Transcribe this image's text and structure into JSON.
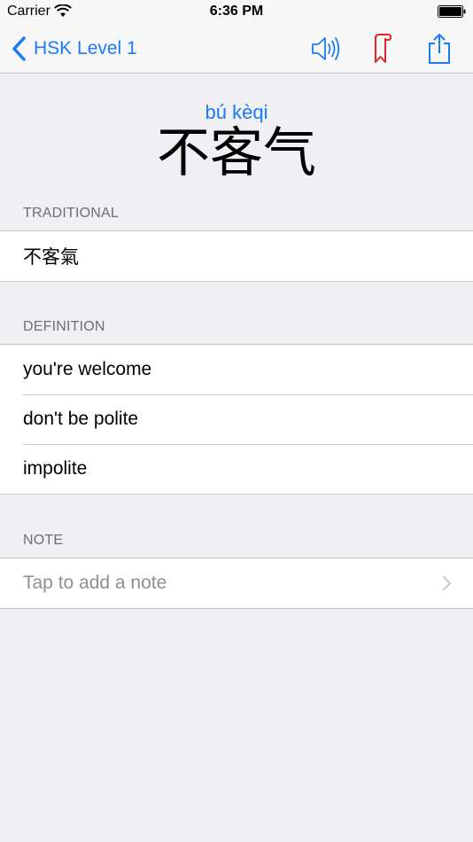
{
  "status_bar": {
    "carrier": "Carrier",
    "time": "6:36 PM"
  },
  "nav": {
    "back_label": "HSK Level 1",
    "icons": [
      "speaker-icon",
      "bookmark-icon",
      "share-icon"
    ]
  },
  "entry": {
    "pinyin": "bú kèqi",
    "simplified": "不客气"
  },
  "sections": {
    "traditional": {
      "header": "TRADITIONAL",
      "value": "不客氣"
    },
    "definition": {
      "header": "DEFINITION",
      "items": [
        "you're welcome",
        "don't be polite",
        "impolite"
      ]
    },
    "note": {
      "header": "NOTE",
      "placeholder": "Tap to add a note"
    }
  },
  "colors": {
    "accent": "#1a7cf5",
    "bookmark": "#e0262b",
    "background": "#efeff4"
  }
}
